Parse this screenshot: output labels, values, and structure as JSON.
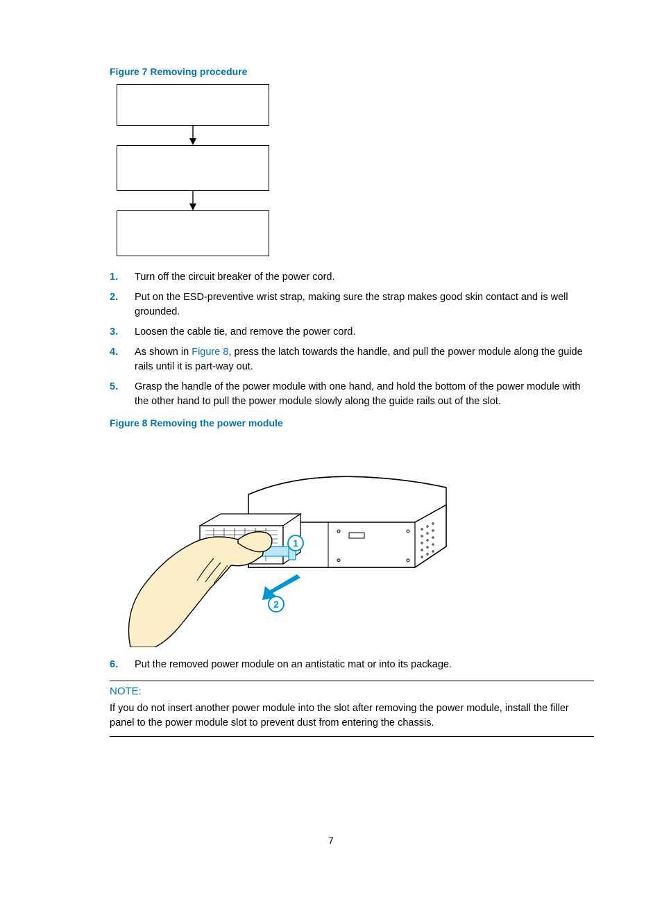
{
  "figure7_caption": "Figure 7 Removing procedure",
  "steps_a": [
    "Turn off the circuit breaker of the power cord.",
    "Put on the ESD-preventive wrist strap, making sure the strap makes good skin contact and is well grounded.",
    "Loosen the cable tie, and remove the power cord."
  ],
  "step4_prefix": "As shown in ",
  "step4_link": "Figure 8",
  "step4_suffix": ", press the latch towards the handle, and pull the power module along the guide rails until it is part-way out.",
  "step5": "Grasp the handle of the power module with one hand, and hold the bottom of the power module with the other hand to pull the power module slowly along the guide rails out of the slot.",
  "figure8_caption": "Figure 8 Removing the power module",
  "step6": "Put the removed power module on an antistatic mat or into its package.",
  "note_title": "NOTE:",
  "note_body": "If you do not insert another power module into the slot after removing the power module, install the filler panel to the power module slot to prevent dust from entering the chassis.",
  "page_number": "7"
}
